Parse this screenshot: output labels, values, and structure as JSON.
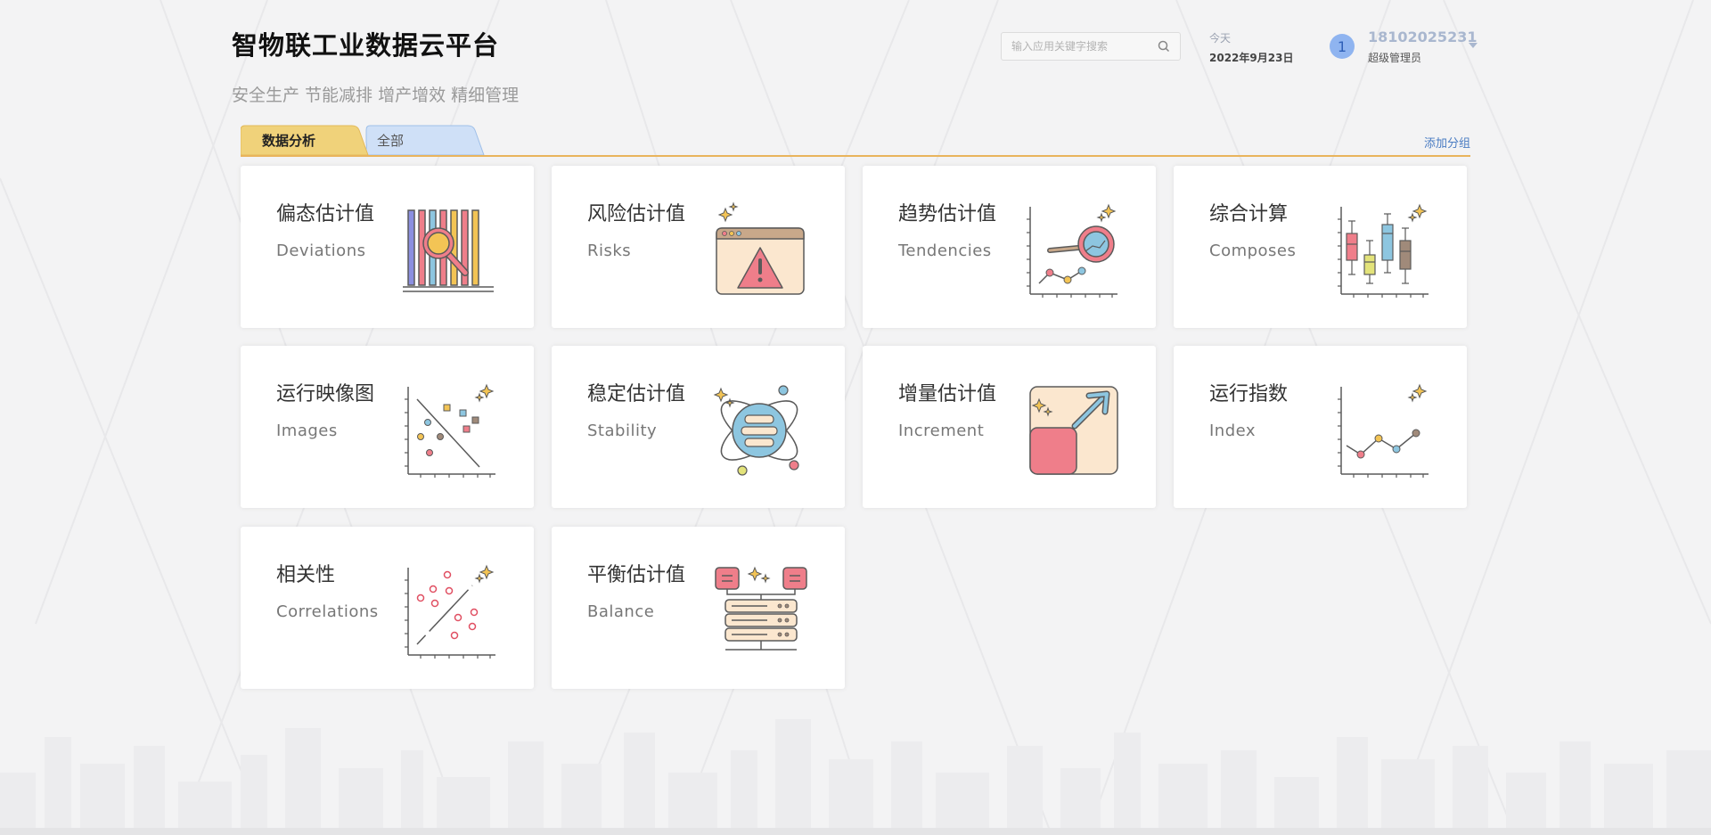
{
  "header": {
    "title": "智物联工业数据云平台",
    "slogan": "安全生产 节能减排 增产增效 精细管理",
    "search_placeholder": "输入应用关键字搜索",
    "date_label": "今天",
    "date_value": "2022年9月23日",
    "avatar_text": "1",
    "user_name": "18102025231",
    "user_role": "超级管理员"
  },
  "tabs": [
    {
      "label": "数据分析",
      "active": true
    },
    {
      "label": "全部",
      "active": false
    }
  ],
  "add_group_label": "添加分组",
  "cards": [
    {
      "title": "偏态估计值",
      "subtitle": "Deviations",
      "icon": "bar-magnifier-icon"
    },
    {
      "title": "风险估计值",
      "subtitle": "Risks",
      "icon": "warning-window-icon"
    },
    {
      "title": "趋势估计值",
      "subtitle": "Tendencies",
      "icon": "trend-magnifier-icon"
    },
    {
      "title": "综合计算",
      "subtitle": "Composes",
      "icon": "boxplot-icon"
    },
    {
      "title": "运行映像图",
      "subtitle": "Images",
      "icon": "scatter-icon"
    },
    {
      "title": "稳定估计值",
      "subtitle": "Stability",
      "icon": "globe-orbit-icon"
    },
    {
      "title": "增量估计值",
      "subtitle": "Increment",
      "icon": "increment-arrow-icon"
    },
    {
      "title": "运行指数",
      "subtitle": "Index",
      "icon": "line-chart-icon"
    },
    {
      "title": "相关性",
      "subtitle": "Correlations",
      "icon": "correlation-icon"
    },
    {
      "title": "平衡估计值",
      "subtitle": "Balance",
      "icon": "server-balance-icon"
    }
  ],
  "colors": {
    "tab_active": "#f0d27a",
    "tab_inactive": "#cfe0f7",
    "tab_underline": "#e9b45c",
    "accent_blue": "#4a7cc2",
    "icon_red": "#ef7e8a",
    "icon_yellow": "#f3c455",
    "icon_blue": "#8dc6e0",
    "icon_outline": "#5a5a5a"
  }
}
